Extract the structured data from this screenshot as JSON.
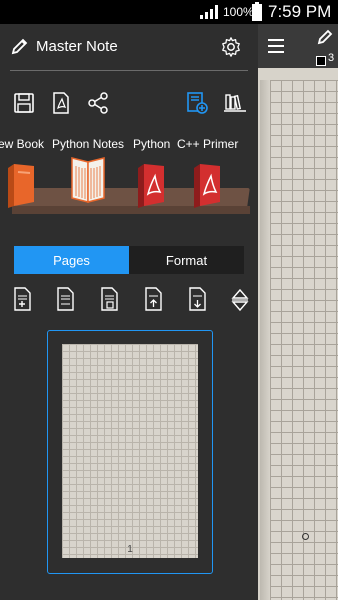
{
  "status_bar": {
    "battery_percent": "100%",
    "time": "7:59 PM"
  },
  "header": {
    "title": "Master Note"
  },
  "books": [
    {
      "label": "ew Book",
      "color": "#e8662a"
    },
    {
      "label": "Python Notes",
      "color": "#f4f1ea"
    },
    {
      "label": "Python",
      "color": "#d32f2f"
    },
    {
      "label": "C++ Primer",
      "color": "#d32f2f"
    }
  ],
  "tabs": {
    "pages_label": "Pages",
    "format_label": "Format",
    "active": "Pages"
  },
  "thumbnail": {
    "page_number": "1"
  },
  "right_toolbar": {
    "pen_size": "3"
  },
  "colors": {
    "accent": "#2196f3",
    "pen_color": "#000000"
  },
  "toolbar_icons": [
    "save-icon",
    "pdf-export-icon",
    "share-icon",
    "add-book-icon",
    "library-icon"
  ],
  "page_tool_icons": [
    "add-page-icon",
    "blank-page-icon",
    "page-template-icon",
    "page-up-icon",
    "page-down-icon",
    "page-sort-icon"
  ]
}
